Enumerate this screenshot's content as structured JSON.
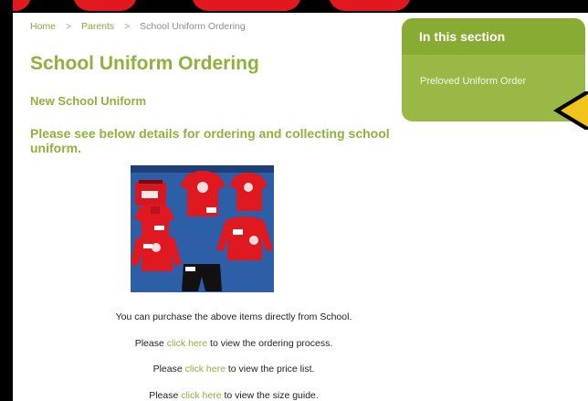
{
  "breadcrumb": {
    "home": "Home",
    "separator": ">",
    "parents": "Parents",
    "current": "School Uniform Ordering"
  },
  "page": {
    "title": "School Uniform Ordering",
    "subtitle": "New School Uniform",
    "intro": "Please see below details for ordering and collecting school uniform."
  },
  "content": {
    "purchase_text": "You can purchase the above items directly from School.",
    "lines": [
      {
        "before": "Please",
        "link": "click here",
        "after": "to view the ordering process."
      },
      {
        "before": "Please",
        "link": "click here",
        "after": "to view the price list."
      },
      {
        "before": "Please",
        "link": "click here",
        "after": "to view the size guide."
      }
    ]
  },
  "sidebar": {
    "heading": "In this section",
    "items": [
      {
        "label": "Preloved Uniform Order"
      }
    ]
  },
  "colors": {
    "accent_green": "#8db33a",
    "sidebar_green": "#9ab846",
    "header_red": "#e1191e",
    "arrow_yellow": "#f0c419"
  },
  "icons": {
    "arrow": "arrow-left-icon"
  }
}
